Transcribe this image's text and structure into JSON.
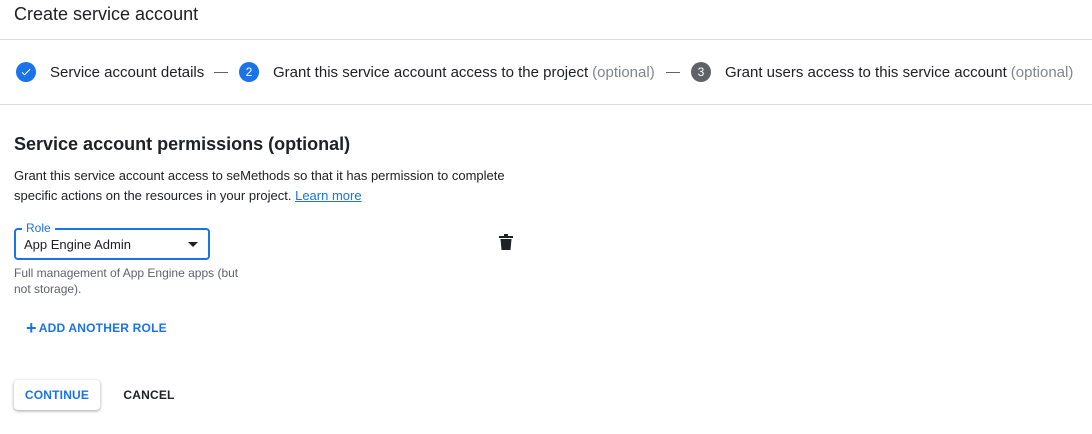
{
  "header": {
    "title": "Create service account"
  },
  "stepper": {
    "steps": [
      {
        "number": "",
        "label": "Service account details",
        "optional": "",
        "state": "done"
      },
      {
        "number": "2",
        "label": "Grant this service account access to the project",
        "optional": "(optional)",
        "state": "active"
      },
      {
        "number": "3",
        "label": "Grant users access to this service account",
        "optional": "(optional)",
        "state": "inactive"
      }
    ]
  },
  "permissions": {
    "title": "Service account permissions (optional)",
    "description": "Grant this service account access to seMethods so that it has permission to complete specific actions on the resources in your project.",
    "learn_more": "Learn more",
    "role_label": "Role",
    "role_value": "App Engine Admin",
    "role_hint": "Full management of App Engine apps (but not storage).",
    "add_role_label": "ADD ANOTHER ROLE"
  },
  "actions": {
    "continue_label": "CONTINUE",
    "cancel_label": "CANCEL"
  },
  "colors": {
    "accent": "#1a73e8",
    "text": "#202124",
    "muted": "#5f6368",
    "divider": "#dadce0"
  }
}
